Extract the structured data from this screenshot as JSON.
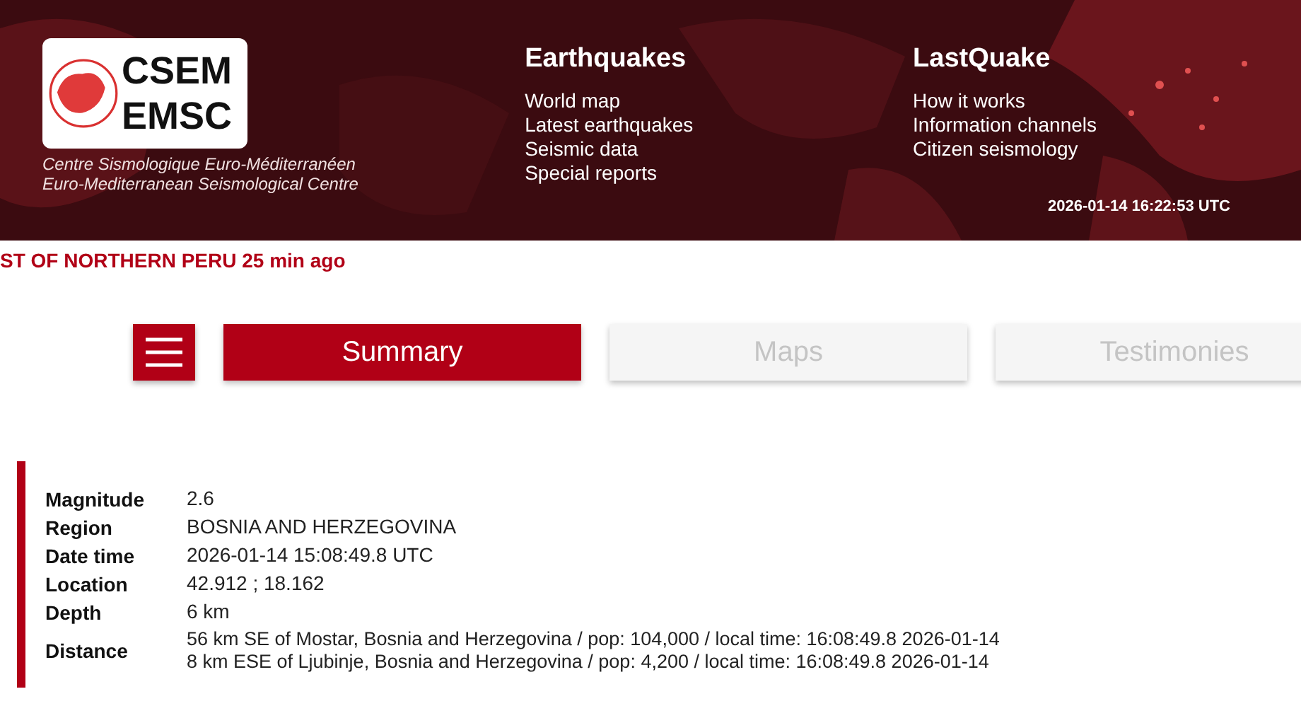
{
  "header": {
    "logo": {
      "line_1": "CSEM",
      "line_2": "EMSC"
    },
    "org_names": [
      "Centre Sismologique Euro-Méditerranéen",
      "Euro-Mediterranean Seismological Centre"
    ],
    "menus": [
      {
        "title": "Earthquakes",
        "links": [
          "World map",
          "Latest earthquakes",
          "Seismic data",
          "Special reports"
        ]
      },
      {
        "title": "LastQuake",
        "links": [
          "How it works",
          "Information channels",
          "Citizen seismology"
        ]
      }
    ],
    "clock": "2026-01-14 16:22:53 UTC"
  },
  "ticker": "ST OF NORTHERN PERU 25 min ago",
  "tabs": [
    {
      "label": "Summary",
      "selected": true
    },
    {
      "label": "Maps",
      "selected": false
    },
    {
      "label": "Testimonies",
      "selected": false
    }
  ],
  "details": [
    {
      "label": "Magnitude",
      "values": [
        "2.6"
      ]
    },
    {
      "label": "Region",
      "values": [
        "BOSNIA AND HERZEGOVINA"
      ]
    },
    {
      "label": "Date time",
      "values": [
        "2026-01-14 15:08:49.8 UTC"
      ]
    },
    {
      "label": "Location",
      "values": [
        "42.912 ; 18.162"
      ]
    },
    {
      "label": "Depth",
      "values": [
        "6 km"
      ]
    },
    {
      "label": "Distance",
      "values": [
        "56 km SE of Mostar, Bosnia and Herzegovina / pop: 104,000 / local time: 16:08:49.8 2026-01-14",
        "8 km ESE of Ljubinje, Bosnia and Herzegovina / pop: 4,200 / local time: 16:08:49.8 2026-01-14"
      ]
    }
  ]
}
